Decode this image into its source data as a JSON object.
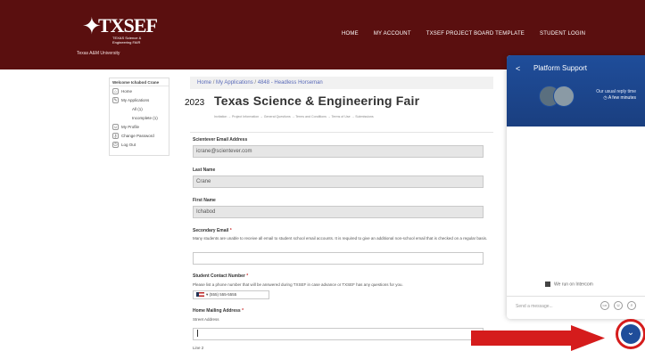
{
  "header": {
    "logo_text": "TXSEF",
    "logo_subtitle": "TEXAS Science & Engineering FAIR",
    "university": "Texas A&M University",
    "nav": [
      "HOME",
      "MY ACCOUNT",
      "TXSEF PROJECT BOARD TEMPLATE",
      "STUDENT LOGIN"
    ]
  },
  "sidebar": {
    "welcome": "Welcome Ichabod Crane",
    "items": [
      {
        "label": "Home",
        "icon": "home-icon"
      },
      {
        "label": "My Applications",
        "icon": "applications-icon"
      },
      {
        "label": "All (1)",
        "icon": ""
      },
      {
        "label": "Incomplete (1)",
        "icon": ""
      },
      {
        "label": "My Profile",
        "icon": "user-icon"
      },
      {
        "label": "Change Password",
        "icon": "key-icon"
      },
      {
        "label": "Log Out",
        "icon": "power-icon"
      }
    ]
  },
  "breadcrumb": {
    "home": "Home",
    "sep1": "/",
    "applications": "My Applications",
    "sep2": "/",
    "current": "4848 - Headless Horseman"
  },
  "page": {
    "year": "2023",
    "title": "Texas Science & Engineering Fair",
    "steps": "Invitation  →  Project Information  →  General Questions  →  Terms and Conditions  →  Terms of Use  →  Submissions"
  },
  "form": {
    "email_label": "Scientever Email Address",
    "email_value": "icrane@scientever.com",
    "last_name_label": "Last Name",
    "last_name_value": "Crane",
    "first_name_label": "First Name",
    "first_name_value": "Ichabod",
    "secondary_email_label": "Secondary Email",
    "required_mark": "*",
    "secondary_email_help": "Many students are unable to receive all email to student school email accounts. It is required to give an additional non-school email that is checked on a regular basis.",
    "secondary_email_value": "",
    "phone_label": "Student Contact Number",
    "phone_help": "Please list a phone number that will be answered during TXSEF in case advance or TXSEF has any questions for you.",
    "phone_value": "(555) 555-5555",
    "phone_country": "▾",
    "address_label": "Home Mailing Address",
    "street_label": "Street Address",
    "street_value": "",
    "line2_label": "Line 2"
  },
  "chat": {
    "back": "<",
    "title": "Platform Support",
    "reply_line1": "Our usual reply time",
    "reply_line2": "A few minutes",
    "powered": "We run on Intercom",
    "send_placeholder": "Send a message...",
    "icon_gif": "GIF",
    "icon_emoji": "☺",
    "icon_attach": "⌕",
    "launcher": "⌄"
  },
  "colors": {
    "header_bg": "#5a0f0f",
    "chat_blue": "#1f4d9a",
    "arrow_red": "#d51c1c"
  }
}
